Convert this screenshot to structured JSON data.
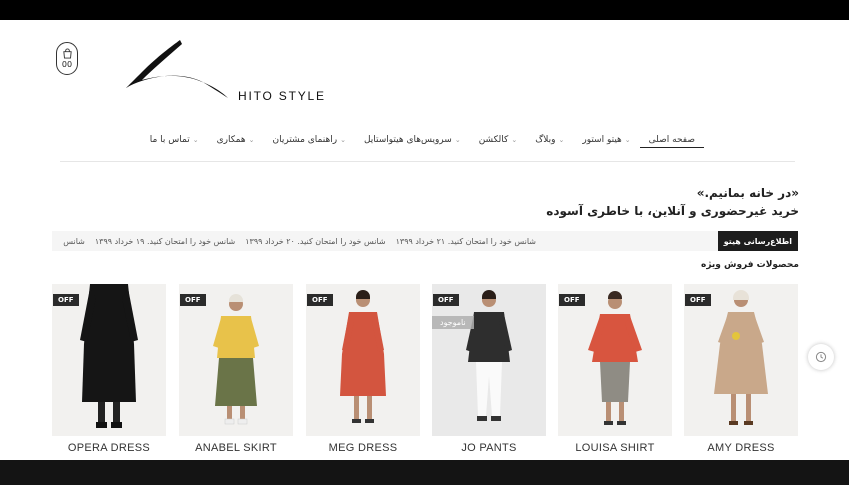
{
  "header": {
    "logo_text": "HITO STYLE",
    "cart_count": "00"
  },
  "nav": {
    "items": [
      {
        "label": "صفحه اصلی",
        "active": true,
        "has_dropdown": false
      },
      {
        "label": "هیتو استور",
        "active": false,
        "has_dropdown": true
      },
      {
        "label": "وبلاگ",
        "active": false,
        "has_dropdown": true
      },
      {
        "label": "کالکشن",
        "active": false,
        "has_dropdown": true
      },
      {
        "label": "سرویس‌های هیتواستایل",
        "active": false,
        "has_dropdown": true
      },
      {
        "label": "راهنمای مشتریان",
        "active": false,
        "has_dropdown": true
      },
      {
        "label": "همکاری",
        "active": false,
        "has_dropdown": true
      },
      {
        "label": "تماس با ما",
        "active": false,
        "has_dropdown": true
      }
    ]
  },
  "hero": {
    "line1": "«در خانه بمانیم.»",
    "line2": "خرید غیرحضوری و آنلاین، با خاطری آسوده"
  },
  "ticker": {
    "label": "اطلاع‌رسانی هیتو",
    "items": [
      "شانس خود را امتحان کنید. ۲۱ خرداد ۱۳۹۹",
      "شانس خود را امتحان کنید. ۲۰ خرداد ۱۳۹۹",
      "شانس خود را امتحان کنید. ۱۹ خرداد ۱۳۹۹",
      "شانس"
    ]
  },
  "special_sale": {
    "title": "محصولات فروش ویژه",
    "products": [
      {
        "name": "AMY DRESS",
        "badge": "OFF",
        "out_of_stock": ""
      },
      {
        "name": "LOUISA SHIRT",
        "badge": "OFF",
        "out_of_stock": ""
      },
      {
        "name": "JO PANTS",
        "badge": "OFF",
        "out_of_stock": "ناموجود"
      },
      {
        "name": "MEG DRESS",
        "badge": "OFF",
        "out_of_stock": ""
      },
      {
        "name": "ANABEL SKIRT",
        "badge": "OFF",
        "out_of_stock": ""
      },
      {
        "name": "OPERA DRESS",
        "badge": "OFF",
        "out_of_stock": ""
      }
    ]
  },
  "colors": {
    "dark": "#1d1d1d",
    "badge": "#2b2b2b"
  }
}
